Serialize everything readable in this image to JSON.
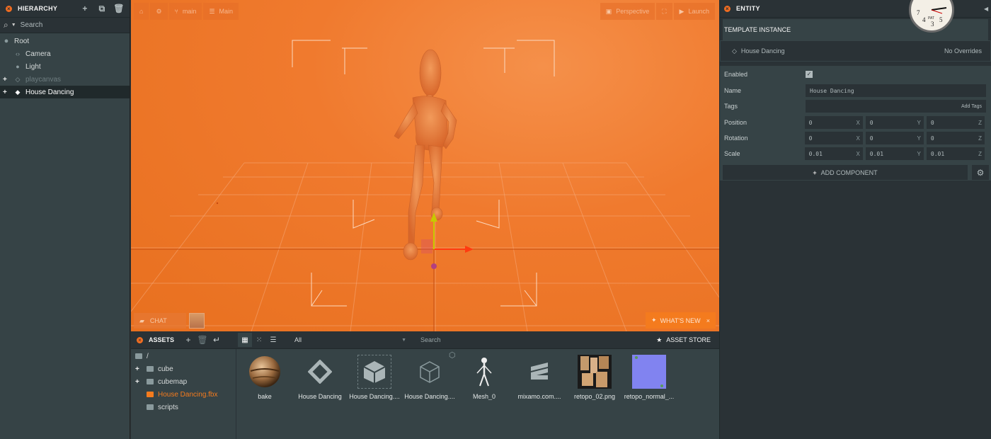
{
  "hierarchy": {
    "title": "HIERARCHY",
    "search_placeholder": "Search",
    "items": [
      {
        "label": "Root"
      },
      {
        "label": "Camera"
      },
      {
        "label": "Light"
      },
      {
        "label": "playcanvas"
      },
      {
        "label": "House Dancing"
      }
    ]
  },
  "viewport": {
    "branch": "main",
    "scene": "Main",
    "camera": "Perspective",
    "launch": "Launch",
    "chat": "CHAT",
    "whats_new": "WHAT'S NEW",
    "close_glyph": "×"
  },
  "assets": {
    "title": "ASSETS",
    "filter": "All",
    "search_placeholder": "Search",
    "store": "ASSET STORE",
    "folders": [
      {
        "label": "/"
      },
      {
        "label": "cube"
      },
      {
        "label": "cubemap"
      },
      {
        "label": "House Dancing.fbx"
      },
      {
        "label": "scripts"
      }
    ],
    "items": [
      {
        "label": "bake"
      },
      {
        "label": "House Dancing"
      },
      {
        "label": "House Dancing...."
      },
      {
        "label": "House Dancing...."
      },
      {
        "label": "Mesh_0"
      },
      {
        "label": "mixamo.com...."
      },
      {
        "label": "retopo_02.png"
      },
      {
        "label": "retopo_normal_..."
      }
    ]
  },
  "entity": {
    "title": "ENTITY",
    "template_title": "TEMPLATE INSTANCE",
    "template_name": "House Dancing",
    "overrides": "No Overrides",
    "enabled_label": "Enabled",
    "name_label": "Name",
    "name_value": "House Dancing",
    "tags_label": "Tags",
    "tags_placeholder": "Add Tags",
    "position_label": "Position",
    "position": [
      "0",
      "0",
      "0"
    ],
    "rotation_label": "Rotation",
    "rotation": [
      "0",
      "0",
      "0"
    ],
    "scale_label": "Scale",
    "scale": [
      "0.01",
      "0.01",
      "0.01"
    ],
    "axes": [
      "X",
      "Y",
      "Z"
    ],
    "add_component": "ADD COMPONENT"
  },
  "clock": {
    "brand": "PAT"
  },
  "colors": {
    "accent": "#f47b1e",
    "viewport": "#ef7a2d",
    "panel": "#364346",
    "panel_dark": "#2a3236"
  }
}
